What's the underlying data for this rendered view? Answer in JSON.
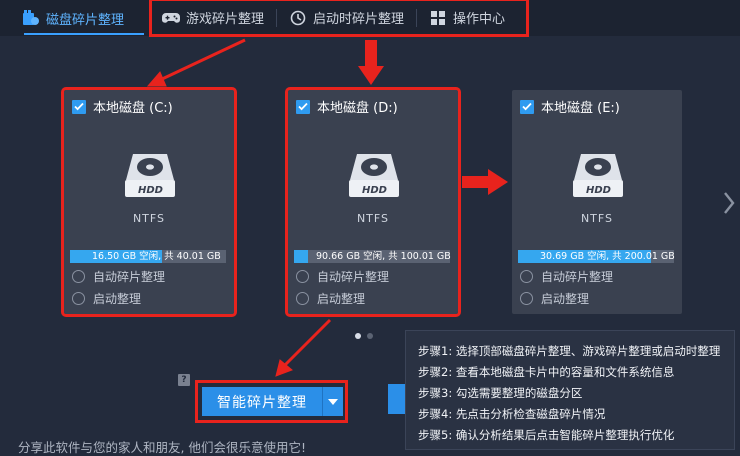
{
  "topbar": {
    "active_tab": "磁盘碎片整理",
    "tabs": [
      {
        "label": "游戏碎片整理",
        "icon": "gamepad-icon"
      },
      {
        "label": "启动时碎片整理",
        "icon": "clock-icon"
      },
      {
        "label": "操作中心",
        "icon": "grid-icon"
      }
    ]
  },
  "drives": [
    {
      "name": "本地磁盘 (C:)",
      "fs": "NTFS",
      "space_text": "16.50 GB 空闲, 共 40.01 GB",
      "used_fraction": 0.59,
      "checked": true
    },
    {
      "name": "本地磁盘 (D:)",
      "fs": "NTFS",
      "space_text": "90.66 GB 空闲, 共 100.01 GB",
      "used_fraction": 0.09,
      "checked": true
    },
    {
      "name": "本地磁盘 (E:)",
      "fs": "NTFS",
      "space_text": "30.69 GB 空闲, 共 200.01 GB",
      "used_fraction": 0.85,
      "checked": true
    }
  ],
  "drive_icon_label": "HDD",
  "options": {
    "auto_defrag": "自动碎片整理",
    "boot_defrag": "启动整理"
  },
  "help_glyph": "?",
  "main_button": {
    "label": "智能碎片整理"
  },
  "steps": [
    "步骤1: 选择顶部磁盘碎片整理、游戏碎片整理或启动时整理",
    "步骤2: 查看本地磁盘卡片中的容量和文件系统信息",
    "步骤3: 勾选需要整理的磁盘分区",
    "步骤4: 先点击分析检查磁盘碎片情况",
    "步骤5: 确认分析结果后点击智能碎片整理执行优化"
  ],
  "share_text": "分享此软件与您的家人和朋友, 他们会很乐意使用它!",
  "colors": {
    "accent": "#2b8fe8",
    "annotation_red": "#e8231d",
    "background": "#232b3c",
    "card": "#3a4150"
  }
}
